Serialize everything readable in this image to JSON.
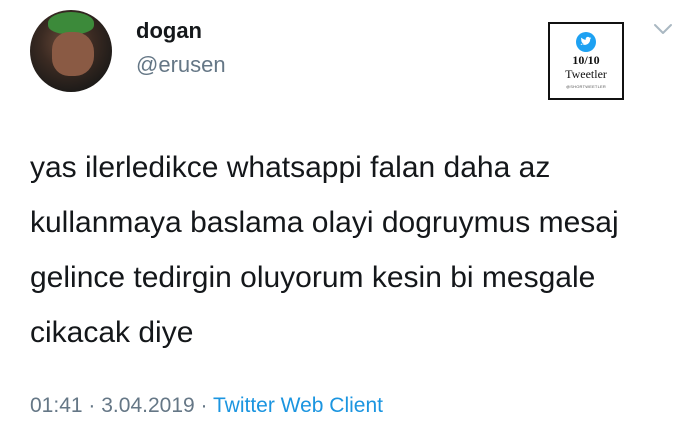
{
  "tweet": {
    "name": "dogan",
    "handle": "@erusen",
    "text": "yas ilerledikce whatsappi falan daha az kullanmaya baslama olayi dogruymus mesaj gelince tedirgin oluyorum kesin bi mesgale cikacak diye",
    "time": "01:41",
    "separator": "·",
    "date": "3.04.2019",
    "source": "Twitter Web Client"
  },
  "badge": {
    "score": "10/10",
    "label": "Tweetler",
    "small": "@SHORTWEETLER"
  },
  "colors": {
    "secondary_text": "#657786",
    "link": "#1b95e0",
    "bird": "#1da1f2"
  },
  "icons": {
    "menu": "chevron-down-icon",
    "bird": "twitter-bird-icon"
  }
}
